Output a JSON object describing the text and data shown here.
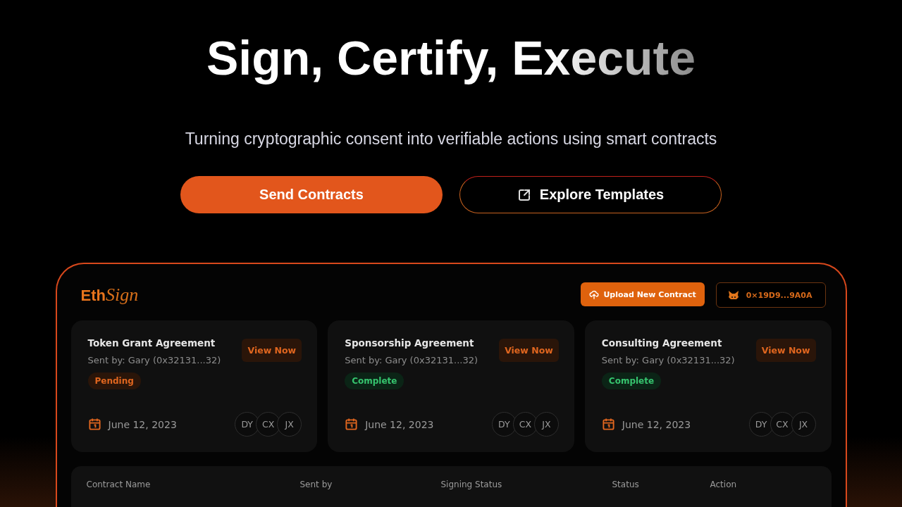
{
  "hero": {
    "title": "Sign, Certify, Execute",
    "subtitle": "Turning cryptographic consent into verifiable actions using smart contracts",
    "primary_button": "Send Contracts",
    "secondary_button": "Explore Templates"
  },
  "dashboard": {
    "logo": {
      "bold": "Eth",
      "script": "Sign"
    },
    "upload_button": "Upload New Contract",
    "wallet": "0×19D9...9A0A",
    "cards": [
      {
        "title": "Token Grant Agreement",
        "sender": "Sent by: Gary (0x32131...32)",
        "action": "View Now",
        "status": {
          "kind": "pending",
          "label": "Pending"
        },
        "date": "June 12, 2023",
        "signers": [
          "DY",
          "CX",
          "JX"
        ]
      },
      {
        "title": "Sponsorship Agreement",
        "sender": "Sent by: Gary (0x32131...32)",
        "action": "View Now",
        "status": {
          "kind": "complete",
          "label": "Complete"
        },
        "date": "June 12, 2023",
        "signers": [
          "DY",
          "CX",
          "JX"
        ]
      },
      {
        "title": "Consulting Agreement",
        "sender": "Sent by: Gary (0x32131...32)",
        "action": "View Now",
        "status": {
          "kind": "complete",
          "label": "Complete"
        },
        "date": "June 12, 2023",
        "signers": [
          "DY",
          "CX",
          "JX"
        ]
      }
    ],
    "table": {
      "columns": [
        "Contract Name",
        "Sent by",
        "Signing Status",
        "Status",
        "Action"
      ]
    }
  }
}
